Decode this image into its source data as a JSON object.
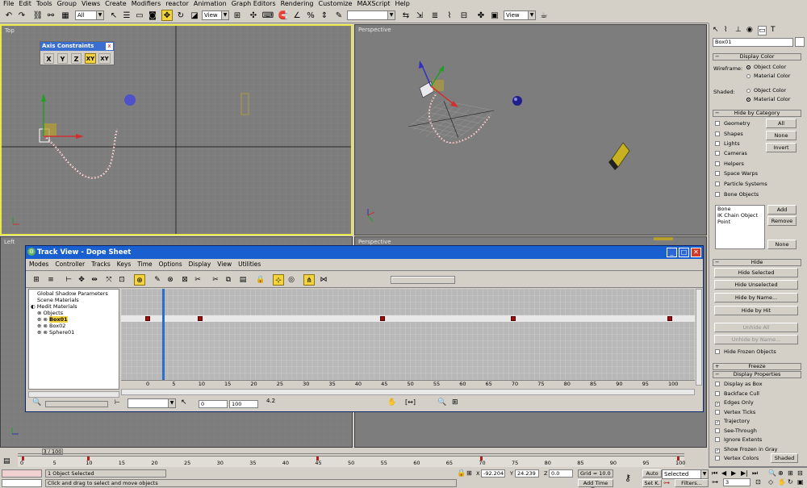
{
  "menu": [
    "File",
    "Edit",
    "Tools",
    "Group",
    "Views",
    "Create",
    "Modifiers",
    "reactor",
    "Animation",
    "Graph Editors",
    "Rendering",
    "Customize",
    "MAXScript",
    "Help"
  ],
  "toolbar": {
    "selection_filter": "All",
    "ref_coord": "View",
    "named_sets": "",
    "view_combo": "View"
  },
  "axis_constraints": {
    "title": "Axis Constraints",
    "close": "x",
    "buttons": [
      "X",
      "Y",
      "Z",
      "XY",
      "XY"
    ]
  },
  "viewports": {
    "top": "Top",
    "perspective": "Perspective",
    "left": "Left",
    "perspective2": "Perspective"
  },
  "command_panel": {
    "object_name": "Box01",
    "display_color": {
      "title": "Display Color",
      "wireframe_label": "Wireframe:",
      "shaded_label": "Shaded:",
      "object_color": "Object Color",
      "material_color": "Material Color"
    },
    "hide_by_category": {
      "title": "Hide by Category",
      "items": [
        "Geometry",
        "Shapes",
        "Lights",
        "Cameras",
        "Helpers",
        "Space Warps",
        "Particle Systems",
        "Bone Objects"
      ],
      "all": "All",
      "none": "None",
      "invert": "Invert",
      "list": [
        "Bone",
        "IK Chain Object",
        "Point"
      ],
      "add": "Add",
      "remove": "Remove",
      "none2": "None"
    },
    "hide": {
      "title": "Hide",
      "buttons": [
        "Hide Selected",
        "Hide Unselected",
        "Hide by Name...",
        "Hide by Hit",
        "Unhide All",
        "Unhide by Name..."
      ],
      "hide_frozen": "Hide Frozen Objects"
    },
    "freeze_title": "Freeze",
    "display_properties": {
      "title": "Display Properties",
      "items": [
        "Display as Box",
        "Backface Cull",
        "Edges Only",
        "Vertex Ticks",
        "Trajectory",
        "See-Through",
        "Ignore Extents",
        "Show Frozen in Gray",
        "Vertex Colors"
      ],
      "checked": [
        false,
        false,
        true,
        false,
        true,
        false,
        false,
        true,
        false
      ],
      "shaded": "Shaded"
    }
  },
  "trackview": {
    "title": "Track View - Dope Sheet",
    "menu": [
      "Modes",
      "Controller",
      "Tracks",
      "Keys",
      "Time",
      "Options",
      "Display",
      "View",
      "Utilities"
    ],
    "tree": [
      "Global Shadow Parameters",
      "Scene Materials",
      "Medit Materials",
      "Objects",
      "Box01",
      "Box02",
      "Sphere01"
    ],
    "ruler": [
      "0",
      "5",
      "10",
      "15",
      "20",
      "25",
      "30",
      "35",
      "40",
      "45",
      "50",
      "55",
      "60",
      "65",
      "70",
      "75",
      "80",
      "85",
      "90",
      "95",
      "100"
    ],
    "keys": [
      0,
      10,
      45,
      70,
      100
    ],
    "current_frame": 3,
    "range_start": "0",
    "range_end": "100",
    "zoom_value": "4.2"
  },
  "timeline": {
    "slider": "3 / 100",
    "ruler": [
      "0",
      "5",
      "10",
      "15",
      "20",
      "25",
      "30",
      "35",
      "40",
      "45",
      "50",
      "55",
      "60",
      "65",
      "70",
      "75",
      "80",
      "85",
      "90",
      "95",
      "100"
    ],
    "keys": [
      0,
      10,
      45,
      70,
      100
    ]
  },
  "status": {
    "selected": "1 Object Selected",
    "prompt": "Click and drag to select and move objects",
    "x_label": "X",
    "x": "-92.204",
    "y_label": "Y",
    "y": "24.239",
    "z_label": "Z",
    "z": "0.0",
    "grid": "Grid = 10.0",
    "add_time_tag": "Add Time Tag",
    "auto": "Auto",
    "setk": "Set K.",
    "key_filter": "Selected",
    "filters": "Filters...",
    "frame": "3"
  }
}
